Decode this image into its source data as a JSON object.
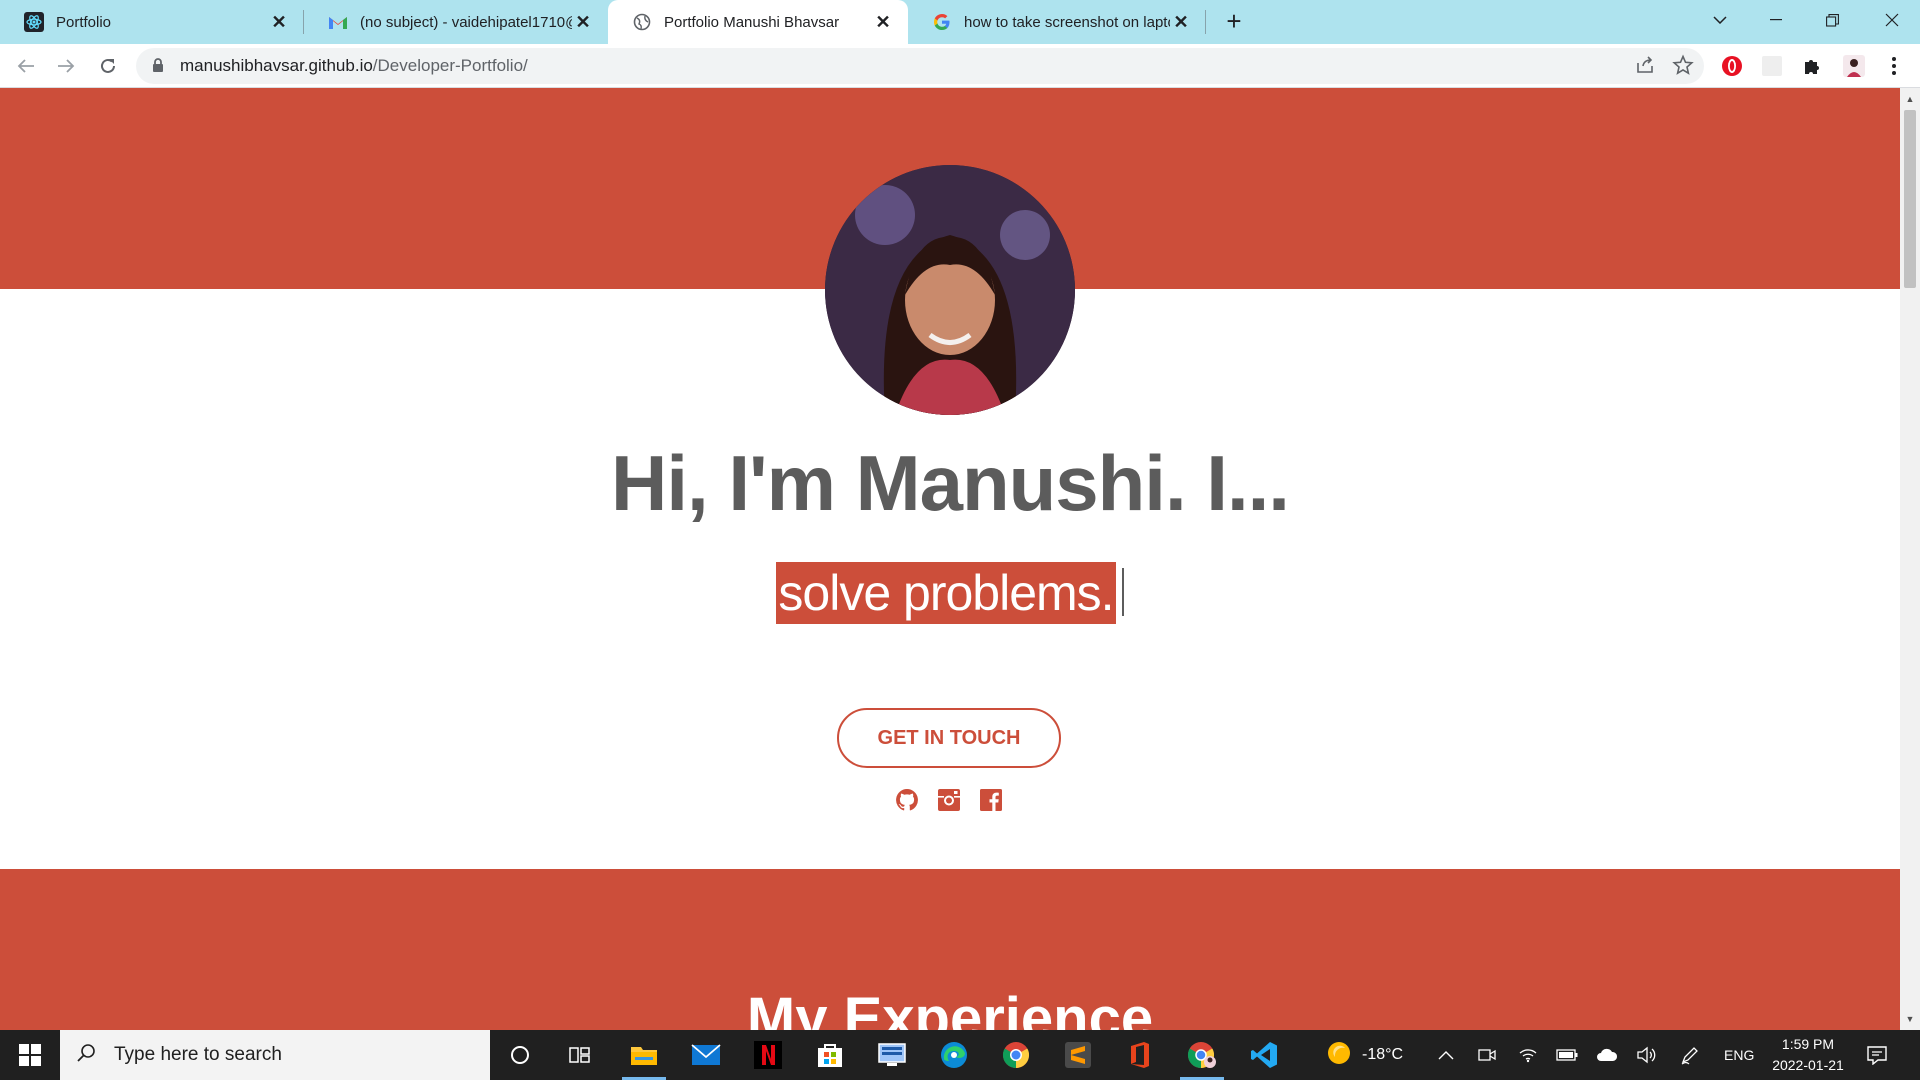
{
  "browser": {
    "tabs": [
      {
        "title": "Portfolio",
        "favicon": "react-icon"
      },
      {
        "title": "(no subject) - vaidehipatel1710@",
        "favicon": "gmail-icon"
      },
      {
        "title": "Portfolio Manushi Bhavsar",
        "favicon": "globe-icon"
      },
      {
        "title": "how to take screenshot on lapto",
        "favicon": "google-icon"
      }
    ],
    "new_tab_label": "+",
    "url_domain": "manushibhavsar.github.io",
    "url_path": "/Developer-Portfolio/"
  },
  "page": {
    "headline": "Hi, I'm Manushi. I...",
    "typed_text": "solve problems.",
    "cta_label": "GET IN TOUCH",
    "socials": [
      "github-icon",
      "instagram-icon",
      "facebook-icon"
    ],
    "section_title": "My Experience",
    "accent_color": "#cc4e3a",
    "heading_color": "#5c5c5c"
  },
  "taskbar": {
    "search_placeholder": "Type here to search",
    "weather": "-18°C",
    "language": "ENG",
    "time": "1:59 PM",
    "date": "2022-01-21"
  }
}
